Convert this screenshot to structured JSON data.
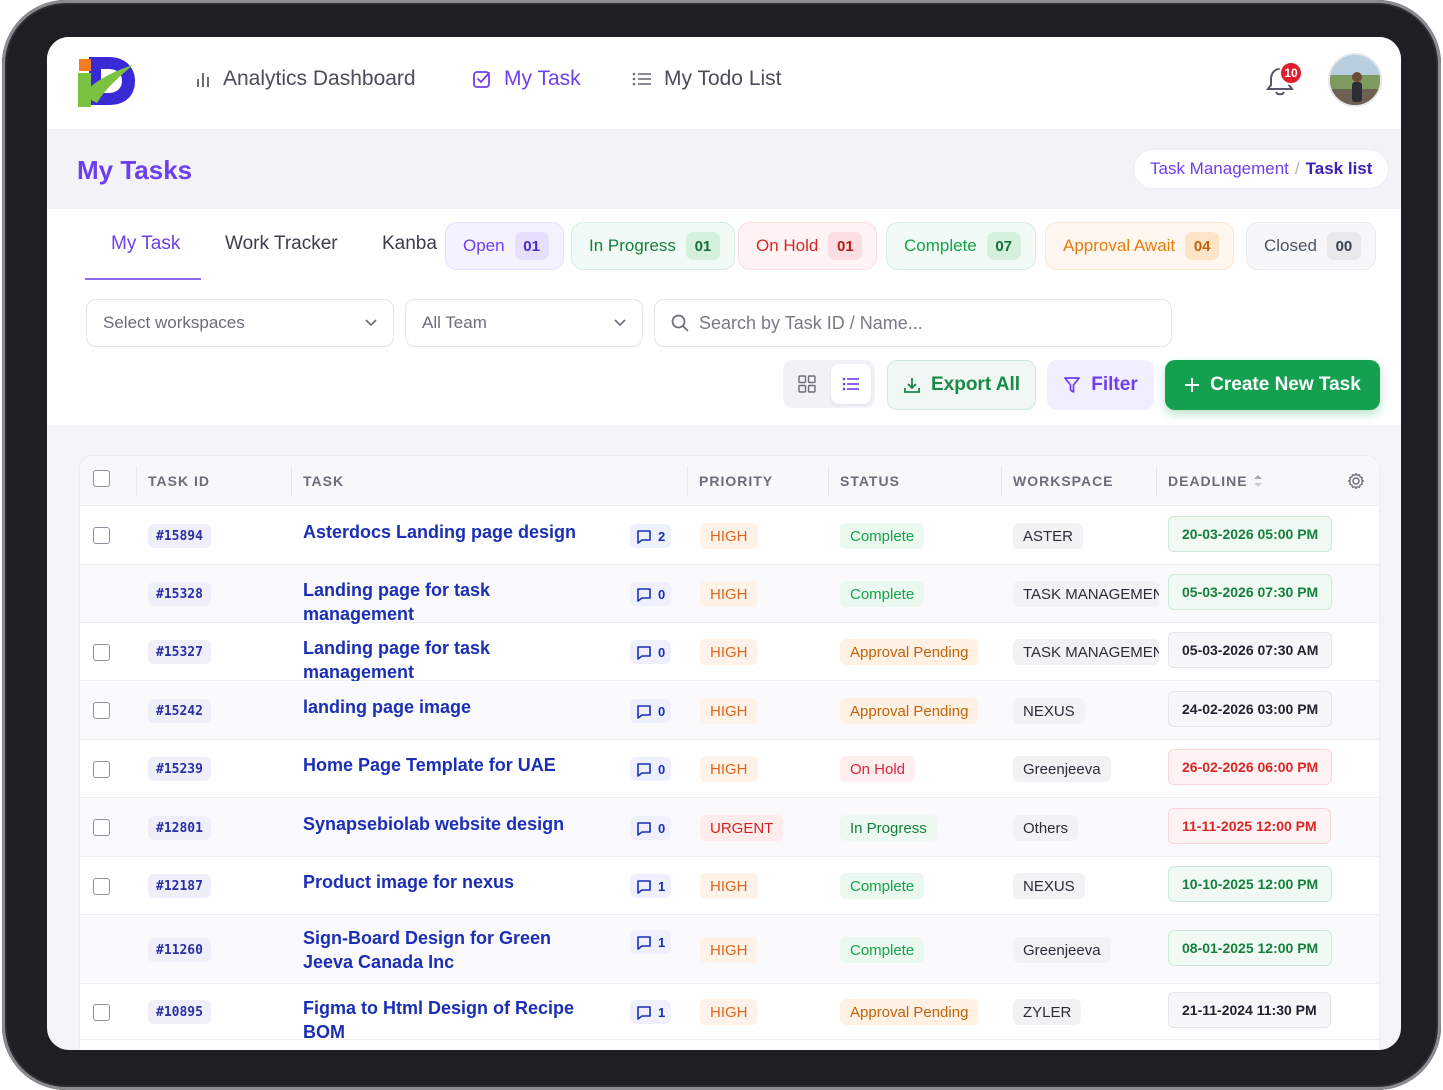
{
  "nav": {
    "items": [
      {
        "label": "Analytics Dashboard",
        "icon": "bar-chart-icon"
      },
      {
        "label": "My Task",
        "icon": "checkbox-edit-icon"
      },
      {
        "label": "My Todo List",
        "icon": "list-icon"
      }
    ],
    "notification_count": "10"
  },
  "page": {
    "title": "My Tasks",
    "breadcrumb": {
      "parent": "Task Management",
      "separator": "/",
      "current": "Task list"
    }
  },
  "tabs": [
    "My Task",
    "Work Tracker",
    "Kanba"
  ],
  "status_chips": [
    {
      "label": "Open",
      "count": "01",
      "color": "#6d3ff0"
    },
    {
      "label": "In Progress",
      "count": "01",
      "color": "#15803d"
    },
    {
      "label": "On Hold",
      "count": "01",
      "color": "#dc2626"
    },
    {
      "label": "Complete",
      "count": "07",
      "color": "#16a34a"
    },
    {
      "label": "Approval Await",
      "count": "04",
      "color": "#ea7a0c"
    },
    {
      "label": "Closed",
      "count": "00",
      "color": "#4b5563"
    }
  ],
  "filters": {
    "workspace_placeholder": "Select workspaces",
    "team_value": "All Team",
    "search_placeholder": "Search by Task ID / Name..."
  },
  "actions": {
    "export_label": "Export All",
    "filter_label": "Filter",
    "create_label": "Create New Task"
  },
  "table": {
    "columns": [
      "TASK ID",
      "TASK",
      "PRIORITY",
      "STATUS",
      "WORKSPACE",
      "DEADLINE"
    ],
    "rows": [
      {
        "id": "#15894",
        "task": "Asterdocs Landing page design",
        "comments": "2",
        "priority": "HIGH",
        "status": "Complete",
        "workspace": "ASTER",
        "deadline": "20-03-2026 05:00 PM",
        "deadline_tone": "green",
        "checkbox": true
      },
      {
        "id": "#15328",
        "task": "Landing page for task management",
        "comments": "0",
        "priority": "HIGH",
        "status": "Complete",
        "workspace": "TASK MANAGEMENT",
        "deadline": "05-03-2026 07:30 PM",
        "deadline_tone": "green",
        "checkbox": false
      },
      {
        "id": "#15327",
        "task": "Landing page for task management",
        "comments": "0",
        "priority": "HIGH",
        "status": "Approval Pending",
        "workspace": "TASK MANAGEMENT",
        "deadline": "05-03-2026 07:30 AM",
        "deadline_tone": "neutral",
        "checkbox": true
      },
      {
        "id": "#15242",
        "task": "landing page image",
        "comments": "0",
        "priority": "HIGH",
        "status": "Approval Pending",
        "workspace": "NEXUS",
        "deadline": "24-02-2026 03:00 PM",
        "deadline_tone": "neutral",
        "checkbox": true
      },
      {
        "id": "#15239",
        "task": "Home Page Template for UAE",
        "comments": "0",
        "priority": "HIGH",
        "status": "On Hold",
        "workspace": "Greenjeeva",
        "deadline": "26-02-2026 06:00 PM",
        "deadline_tone": "red",
        "checkbox": true
      },
      {
        "id": "#12801",
        "task": "Synapsebiolab website design",
        "comments": "0",
        "priority": "URGENT",
        "status": "In Progress",
        "workspace": "Others",
        "deadline": "11-11-2025 12:00 PM",
        "deadline_tone": "red",
        "checkbox": true
      },
      {
        "id": "#12187",
        "task": "Product image for nexus",
        "comments": "1",
        "priority": "HIGH",
        "status": "Complete",
        "workspace": "NEXUS",
        "deadline": "10-10-2025 12:00 PM",
        "deadline_tone": "green",
        "checkbox": true
      },
      {
        "id": "#11260",
        "task": "Sign-Board Design for Green Jeeva Canada Inc",
        "comments": "1",
        "priority": "HIGH",
        "status": "Complete",
        "workspace": "Greenjeeva",
        "deadline": "08-01-2025 12:00 PM",
        "deadline_tone": "green",
        "checkbox": false
      },
      {
        "id": "#10895",
        "task": "Figma to Html Design of Recipe BOM",
        "comments": "1",
        "priority": "HIGH",
        "status": "Approval Pending",
        "workspace": "ZYLER",
        "deadline": "21-11-2024 11:30 PM",
        "deadline_tone": "neutral",
        "checkbox": true
      }
    ]
  },
  "colors": {
    "accent": "#6d3ff0",
    "primary_button": "#15a04f",
    "link": "#1b2fb5"
  }
}
